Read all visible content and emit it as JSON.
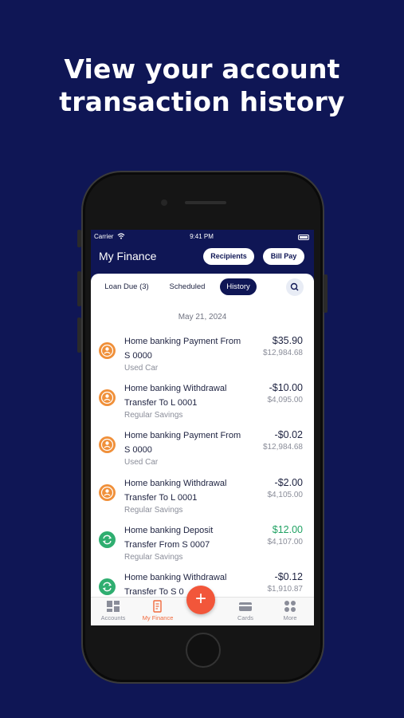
{
  "headline": {
    "line1": "View your account",
    "line2": "transaction history"
  },
  "status_bar": {
    "carrier": "Carrier",
    "time": "9:41 PM"
  },
  "header": {
    "title": "My Finance",
    "recipients_label": "Recipients",
    "billpay_label": "Bill Pay"
  },
  "tabs": [
    {
      "label": "Loan Due (3)",
      "active": false
    },
    {
      "label": "Scheduled",
      "active": false
    },
    {
      "label": "History",
      "active": true
    }
  ],
  "date_group": "May 21, 2024",
  "transactions": [
    {
      "line1": "Home banking Payment From",
      "line2": "S 0000",
      "account": "Used Car",
      "amount": "$35.90",
      "balance": "$12,984.68",
      "icon": "person-icon",
      "icon_color": "#f0903a",
      "credit": false
    },
    {
      "line1": "Home banking Withdrawal",
      "line2": "Transfer To L 0001",
      "account": "Regular Savings",
      "amount": "-$10.00",
      "balance": "$4,095.00",
      "icon": "person-icon",
      "icon_color": "#f0903a",
      "credit": false
    },
    {
      "line1": "Home banking Payment From",
      "line2": "S 0000",
      "account": "Used Car",
      "amount": "-$0.02",
      "balance": "$12,984.68",
      "icon": "person-icon",
      "icon_color": "#f0903a",
      "credit": false
    },
    {
      "line1": "Home banking Withdrawal",
      "line2": "Transfer To L 0001",
      "account": "Regular Savings",
      "amount": "-$2.00",
      "balance": "$4,105.00",
      "icon": "person-icon",
      "icon_color": "#f0903a",
      "credit": false
    },
    {
      "line1": "Home banking Deposit",
      "line2": "Transfer From S 0007",
      "account": "Regular Savings",
      "amount": "$12.00",
      "balance": "$4,107.00",
      "icon": "transfer-icon",
      "icon_color": "#2fae70",
      "credit": true
    },
    {
      "line1": "Home banking Withdrawal",
      "line2": "Transfer To S 0",
      "account": "",
      "amount": "-$0.12",
      "balance": "$1,910.87",
      "icon": "transfer-icon",
      "icon_color": "#2fae70",
      "credit": false
    }
  ],
  "tabbar": {
    "accounts_label": "Accounts",
    "finance_label": "My Finance",
    "cards_label": "Cards",
    "more_label": "More",
    "fab_label": "+"
  },
  "colors": {
    "brand": "#0f1655",
    "accent": "#f16a3d",
    "credit": "#20a263"
  }
}
